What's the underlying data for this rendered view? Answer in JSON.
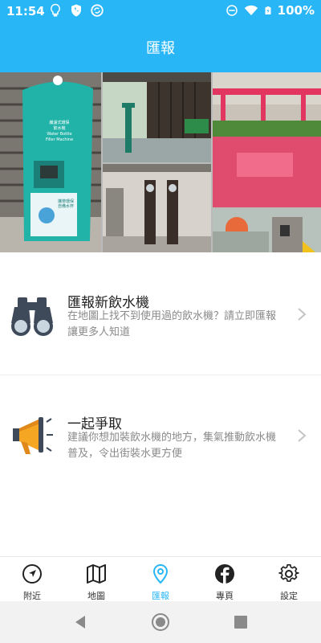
{
  "status_bar": {
    "time": "11:54",
    "battery_percent": "100%",
    "icons_left": [
      "lightbulb-icon",
      "phone-shield-icon",
      "sync-icon"
    ],
    "icons_right": [
      "do-not-disturb-icon",
      "wifi-icon",
      "battery-charging-icon"
    ]
  },
  "header": {
    "title": "匯報"
  },
  "collage": {
    "images": [
      "water-dispenser-photo",
      "fountain-pavilion-photo",
      "pink-pergola-photo",
      "wall-fountains-photo",
      "plaza-dispenser-photo"
    ],
    "kiosk_sign": [
      "纖濾式環保",
      "飲水機",
      "Water Bottle",
      "Filler Machine"
    ],
    "kiosk_sub": "攜帶環保 自備水杯"
  },
  "list": [
    {
      "title": "匯報新飲水機",
      "description": "在地圖上找不到使用過的飲水機？請立即匯報讓更多人知道",
      "icon": "binoculars-icon"
    },
    {
      "title": "一起爭取",
      "description": "建議你想加裝飲水機的地方，集氣推動飲水機普及，令出街裝水更方便",
      "icon": "megaphone-icon"
    }
  ],
  "bottom_nav": [
    {
      "label": "附近",
      "icon": "navigation-arrow-icon",
      "active": false
    },
    {
      "label": "地圖",
      "icon": "map-icon",
      "active": false
    },
    {
      "label": "匯報",
      "icon": "location-pin-icon",
      "active": true
    },
    {
      "label": "專頁",
      "icon": "facebook-icon",
      "active": false
    },
    {
      "label": "設定",
      "icon": "gear-icon",
      "active": false
    }
  ],
  "colors": {
    "primary": "#29b6f6",
    "text": "#222222",
    "subtext": "#8a8a8a"
  }
}
